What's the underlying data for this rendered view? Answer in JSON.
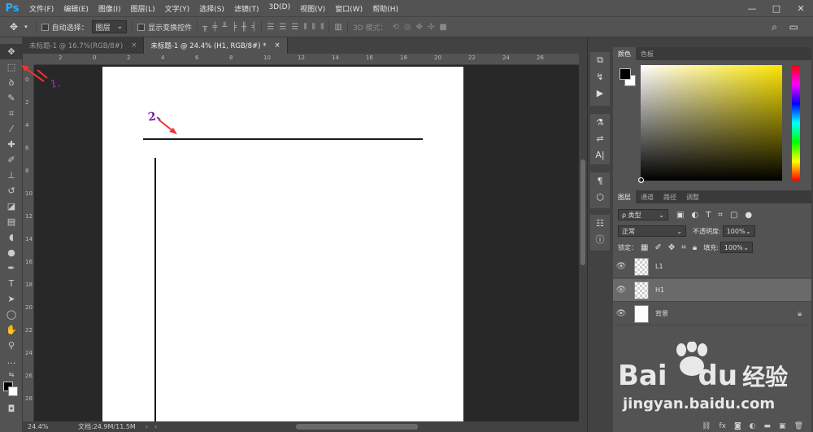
{
  "app": {
    "logo": "Ps"
  },
  "menu": [
    "文件(F)",
    "编辑(E)",
    "图像(I)",
    "图层(L)",
    "文字(Y)",
    "选择(S)",
    "滤镜(T)",
    "3D(D)",
    "视图(V)",
    "窗口(W)",
    "帮助(H)"
  ],
  "window_controls": {
    "minimize": "—",
    "maximize": "□",
    "close": "✕"
  },
  "options": {
    "auto_select_label": "自动选择：",
    "auto_select_value": "图层",
    "transform_label": "显示变换控件",
    "mode_3d_label": "3D 模式："
  },
  "tabs": [
    {
      "label": "未标题-1 @ 16.7%(RGB/8#)",
      "close": "×"
    },
    {
      "label": "未标题-1 @ 24.4% (H1, RGB/8#) *",
      "close": "×"
    }
  ],
  "ruler_top": [
    "4",
    "2",
    "0",
    "2",
    "4",
    "6",
    "8",
    "10",
    "12",
    "14",
    "16",
    "18",
    "20",
    "22",
    "24",
    "26"
  ],
  "ruler_left": [
    "2",
    "0",
    "2",
    "4",
    "6",
    "8",
    "10",
    "12",
    "14",
    "16",
    "18",
    "20",
    "22",
    "24",
    "26",
    "28"
  ],
  "annotations": {
    "one": "1.",
    "two": "2、"
  },
  "status": {
    "zoom": "24.4%",
    "doc": "文档:24.9M/11.5M"
  },
  "color_panel": {
    "tabs": [
      "颜色",
      "色板"
    ],
    "fg_color": "#000000",
    "bg_color": "#ffffff"
  },
  "layers_panel": {
    "tabs": [
      "图层",
      "通道",
      "路径",
      "调整"
    ],
    "filter_label": "ρ 类型",
    "blend_mode": "正常",
    "opacity_label": "不透明度:",
    "opacity_value": "100%",
    "lock_label": "锁定：",
    "fill_label": "填充:",
    "fill_value": "100%",
    "layers": [
      {
        "name": "L1",
        "selected": false
      },
      {
        "name": "H1",
        "selected": true
      },
      {
        "name": "背景",
        "selected": false
      }
    ]
  },
  "watermark": {
    "brand": "Bai",
    "brand2": "du",
    "suffix": "经验",
    "url": "jingyan.baidu.com"
  }
}
